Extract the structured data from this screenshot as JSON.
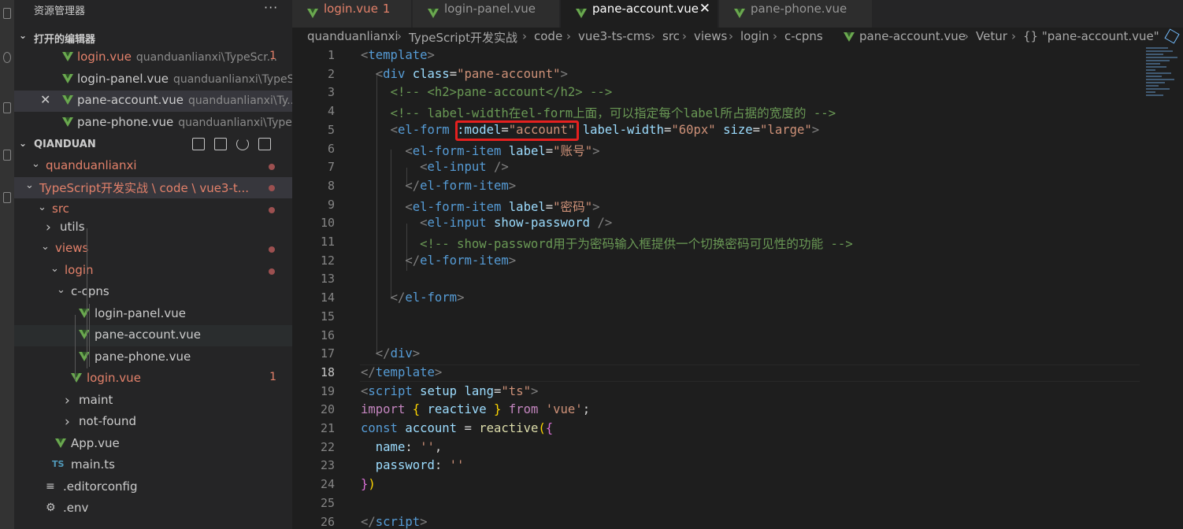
{
  "sidebar": {
    "title": "资源管理器",
    "more": "···",
    "open_editors": {
      "label": "打开的编辑器",
      "items": [
        {
          "name": "login.vue",
          "path": "quanduanlianxi\\TypeScr...",
          "badge": "1",
          "error": true
        },
        {
          "name": "login-panel.vue",
          "path": "quanduanlianxi\\TypeS...",
          "badge": "",
          "error": false
        },
        {
          "name": "pane-account.vue",
          "path": "quanduanlianxi\\Ty...",
          "badge": "",
          "error": false,
          "close": "✕"
        },
        {
          "name": "pane-phone.vue",
          "path": "quanduanlianxi\\Type...",
          "badge": "",
          "error": false
        }
      ]
    },
    "workspace": {
      "label": "QIANDUAN",
      "tree": [
        {
          "label": "quanduanlianxi",
          "error": true
        },
        {
          "label": "TypeScript开发实战 \\ code \\ vue3-t...",
          "error": true
        },
        {
          "label": "src",
          "error": true
        },
        {
          "label": "utils",
          "error": false
        },
        {
          "label": "views",
          "error": true
        },
        {
          "label": "login",
          "error": true
        },
        {
          "label": "c-cpns",
          "error": false
        },
        {
          "label": "login-panel.vue",
          "error": false
        },
        {
          "label": "pane-account.vue",
          "error": false
        },
        {
          "label": "pane-phone.vue",
          "error": false
        },
        {
          "label": "login.vue",
          "error": true,
          "badge": "1"
        },
        {
          "label": "maint",
          "error": false
        },
        {
          "label": "not-found",
          "error": false
        },
        {
          "label": "App.vue",
          "error": false
        },
        {
          "label": "main.ts",
          "error": false,
          "icon_text": "TS"
        },
        {
          "label": ".editorconfig",
          "error": false
        },
        {
          "label": ".env",
          "error": false
        }
      ]
    }
  },
  "tabs": [
    {
      "label": "login.vue",
      "badge": "1",
      "error": true
    },
    {
      "label": "login-panel.vue",
      "badge": "",
      "error": false
    },
    {
      "label": "pane-account.vue",
      "badge": "",
      "error": false,
      "close": "✕"
    },
    {
      "label": "pane-phone.vue",
      "badge": "",
      "error": false
    }
  ],
  "breadcrumb": [
    "quanduanlianxi",
    "TypeScript开发实战",
    "code",
    "vue3-ts-cms",
    "src",
    "views",
    "login",
    "c-cpns",
    "pane-account.vue",
    "Vetur",
    "{} \"pane-account.vue\""
  ],
  "editor": {
    "current_line": "18",
    "line_numbers": [
      "1",
      "2",
      "3",
      "4",
      "5",
      "6",
      "7",
      "8",
      "9",
      "10",
      "11",
      "12",
      "13",
      "14",
      "15",
      "16",
      "17",
      "18",
      "19",
      "20",
      "21",
      "22",
      "23",
      "24",
      "25",
      "26"
    ],
    "lines": [
      [
        [
          "tk-punc",
          "<"
        ],
        [
          "tk-tag",
          "template"
        ],
        [
          "tk-punc",
          ">"
        ]
      ],
      [
        [
          "tk-txt",
          "  "
        ],
        [
          "tk-punc",
          "<"
        ],
        [
          "tk-tag",
          "div"
        ],
        [
          "tk-txt",
          " "
        ],
        [
          "tk-attr",
          "class"
        ],
        [
          "tk-txt",
          "="
        ],
        [
          "tk-str",
          "\"pane-account\""
        ],
        [
          "tk-punc",
          ">"
        ]
      ],
      [
        [
          "tk-txt",
          "    "
        ],
        [
          "tk-com",
          "<!-- <h2>pane-account</h2> -->"
        ]
      ],
      [
        [
          "tk-txt",
          "    "
        ],
        [
          "tk-com",
          "<!-- label-width在el-form上面，可以指定每个label所占据的宽度的 -->"
        ]
      ],
      [
        [
          "tk-txt",
          "    "
        ],
        [
          "tk-punc",
          "<"
        ],
        [
          "tk-tag",
          "el-form"
        ],
        [
          "tk-txt",
          " "
        ],
        [
          "tk-attr",
          ":model"
        ],
        [
          "tk-txt",
          "="
        ],
        [
          "tk-str",
          "\"account\""
        ],
        [
          "tk-txt",
          " "
        ],
        [
          "tk-attr",
          "label-width"
        ],
        [
          "tk-txt",
          "="
        ],
        [
          "tk-str",
          "\"60px\""
        ],
        [
          "tk-txt",
          " "
        ],
        [
          "tk-attr",
          "size"
        ],
        [
          "tk-txt",
          "="
        ],
        [
          "tk-str",
          "\"large\""
        ],
        [
          "tk-punc",
          ">"
        ]
      ],
      [
        [
          "tk-txt",
          "      "
        ],
        [
          "tk-punc",
          "<"
        ],
        [
          "tk-tag",
          "el-form-item"
        ],
        [
          "tk-txt",
          " "
        ],
        [
          "tk-attr",
          "label"
        ],
        [
          "tk-txt",
          "="
        ],
        [
          "tk-str",
          "\"账号\""
        ],
        [
          "tk-punc",
          ">"
        ]
      ],
      [
        [
          "tk-txt",
          "        "
        ],
        [
          "tk-punc",
          "<"
        ],
        [
          "tk-tag",
          "el-input"
        ],
        [
          "tk-txt",
          " "
        ],
        [
          "tk-punc",
          "/>"
        ]
      ],
      [
        [
          "tk-txt",
          "      "
        ],
        [
          "tk-punc",
          "</"
        ],
        [
          "tk-tag",
          "el-form-item"
        ],
        [
          "tk-punc",
          ">"
        ]
      ],
      [
        [
          "tk-txt",
          "      "
        ],
        [
          "tk-punc",
          "<"
        ],
        [
          "tk-tag",
          "el-form-item"
        ],
        [
          "tk-txt",
          " "
        ],
        [
          "tk-attr",
          "label"
        ],
        [
          "tk-txt",
          "="
        ],
        [
          "tk-str",
          "\"密码\""
        ],
        [
          "tk-punc",
          ">"
        ]
      ],
      [
        [
          "tk-txt",
          "        "
        ],
        [
          "tk-punc",
          "<"
        ],
        [
          "tk-tag",
          "el-input"
        ],
        [
          "tk-txt",
          " "
        ],
        [
          "tk-attr",
          "show-password"
        ],
        [
          "tk-txt",
          " "
        ],
        [
          "tk-punc",
          "/>"
        ]
      ],
      [
        [
          "tk-txt",
          "        "
        ],
        [
          "tk-com",
          "<!-- show-password用于为密码输入框提供一个切换密码可见性的功能 -->"
        ]
      ],
      [
        [
          "tk-txt",
          "      "
        ],
        [
          "tk-punc",
          "</"
        ],
        [
          "tk-tag",
          "el-form-item"
        ],
        [
          "tk-punc",
          ">"
        ]
      ],
      [],
      [
        [
          "tk-txt",
          "    "
        ],
        [
          "tk-punc",
          "</"
        ],
        [
          "tk-tag",
          "el-form"
        ],
        [
          "tk-punc",
          ">"
        ]
      ],
      [],
      [],
      [
        [
          "tk-txt",
          "  "
        ],
        [
          "tk-punc",
          "</"
        ],
        [
          "tk-tag",
          "div"
        ],
        [
          "tk-punc",
          ">"
        ]
      ],
      [
        [
          "tk-punc",
          "</"
        ],
        [
          "tk-tag",
          "template"
        ],
        [
          "tk-punc",
          ">"
        ]
      ],
      [
        [
          "tk-punc",
          "<"
        ],
        [
          "tk-tag",
          "script"
        ],
        [
          "tk-txt",
          " "
        ],
        [
          "tk-attr",
          "setup"
        ],
        [
          "tk-txt",
          " "
        ],
        [
          "tk-attr",
          "lang"
        ],
        [
          "tk-txt",
          "="
        ],
        [
          "tk-str",
          "\"ts\""
        ],
        [
          "tk-punc",
          ">"
        ]
      ],
      [
        [
          "tk-kw",
          "import"
        ],
        [
          "tk-txt",
          " "
        ],
        [
          "tk-br1",
          "{"
        ],
        [
          "tk-txt",
          " "
        ],
        [
          "tk-var",
          "reactive"
        ],
        [
          "tk-txt",
          " "
        ],
        [
          "tk-br1",
          "}"
        ],
        [
          "tk-txt",
          " "
        ],
        [
          "tk-kw",
          "from"
        ],
        [
          "tk-txt",
          " "
        ],
        [
          "tk-str",
          "'vue'"
        ],
        [
          "tk-txt",
          ";"
        ]
      ],
      [
        [
          "tk-kw2",
          "const"
        ],
        [
          "tk-txt",
          " "
        ],
        [
          "tk-var",
          "account"
        ],
        [
          "tk-txt",
          " = "
        ],
        [
          "tk-fn",
          "reactive"
        ],
        [
          "tk-br1",
          "("
        ],
        [
          "tk-br2",
          "{"
        ]
      ],
      [
        [
          "tk-txt",
          "  "
        ],
        [
          "tk-var",
          "name"
        ],
        [
          "tk-txt",
          ": "
        ],
        [
          "tk-str",
          "''"
        ],
        [
          "tk-txt",
          ","
        ]
      ],
      [
        [
          "tk-txt",
          "  "
        ],
        [
          "tk-var",
          "password"
        ],
        [
          "tk-txt",
          ": "
        ],
        [
          "tk-str",
          "''"
        ]
      ],
      [
        [
          "tk-br2",
          "}"
        ],
        [
          "tk-br1",
          ")"
        ]
      ],
      [],
      [
        [
          "tk-punc",
          "</"
        ],
        [
          "tk-tag",
          "script"
        ],
        [
          "tk-punc",
          ">"
        ]
      ]
    ]
  },
  "colors": {
    "error": "#e3816a",
    "highlight_box": "#e5201f",
    "vue_icon": "#6aa84f"
  }
}
